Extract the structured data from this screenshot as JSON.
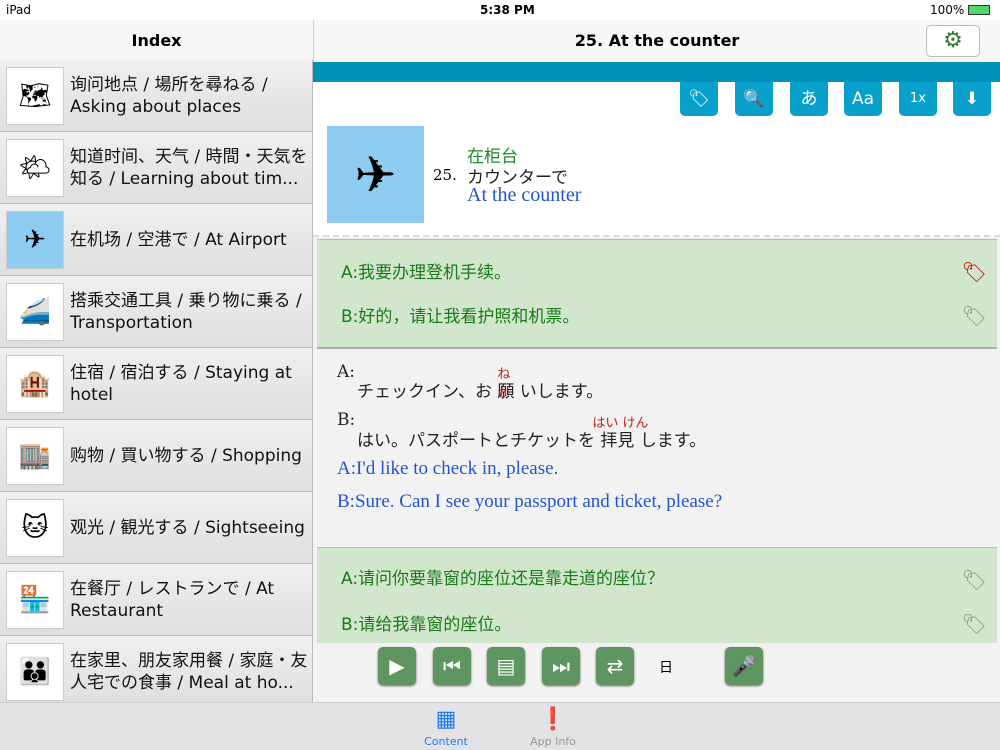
{
  "status": {
    "device": "iPad",
    "time": "5:38 PM",
    "battery": "100%"
  },
  "nav": {
    "left_title": "Index",
    "right_title": "25. At the counter"
  },
  "sidebar": {
    "items": [
      {
        "label": "询问地点 / 場所を尋ねる / Asking about places",
        "icon": "🗺"
      },
      {
        "label": "知道时间、天气 / 時間・天気を知る / Learning about tim...",
        "icon": "🌤"
      },
      {
        "label": "在机场 / 空港で / At Airport",
        "icon": "✈"
      },
      {
        "label": "搭乘交通工具 / 乗り物に乗る / Transportation",
        "icon": "🚄"
      },
      {
        "label": "住宿 / 宿泊する / Staying at hotel",
        "icon": "🏨"
      },
      {
        "label": "购物 / 買い物する / Shopping",
        "icon": "🏬"
      },
      {
        "label": "观光 / 観光する / Sightseeing",
        "icon": "🐱"
      },
      {
        "label": "在餐厅 / レストランで / At Restaurant",
        "icon": "🏪"
      },
      {
        "label": "在家里、朋友家用餐 / 家庭・友人宅での食事 / Meal at ho...",
        "icon": "👪"
      }
    ]
  },
  "toolbar": {
    "tag": "🏷",
    "search": "🔍",
    "kana": "あ",
    "font": "Aa",
    "speed": "1x",
    "download": "⬇"
  },
  "lesson": {
    "number": "25.",
    "zh": "在柜台",
    "ja": "カウンターで",
    "en": "At the counter",
    "image": "✈"
  },
  "dialog1": {
    "zh_a": "A:我要办理登机手续。",
    "zh_b": "B:好的，请让我看护照和机票。",
    "ja_a_label": "A:",
    "ja_a_pre": "チェックイン、お",
    "ja_a_kanji": "願",
    "ja_a_ruby": "ねが",
    "ja_a_post": "いします。",
    "ja_b_label": "B:",
    "ja_b_pre": "はい。パスポートとチケットを",
    "ja_b_kanji": "拝見",
    "ja_b_ruby": "はい けん",
    "ja_b_post": "します。",
    "en_a": "A:I'd like to check in, please.",
    "en_b": "B:Sure. Can I see your passport and ticket, please?"
  },
  "dialog2": {
    "zh_a": "A:请问你要靠窗的座位还是靠走道的座位？",
    "zh_b": "B:请给我靠窗的座位。"
  },
  "controls": {
    "lang": "日"
  },
  "tabs": [
    {
      "label": "Content",
      "active": true
    },
    {
      "label": "App Info",
      "active": false
    }
  ],
  "colors": {
    "accent": "#0aa0cc",
    "green": "#5e9560",
    "tab_active": "#1a7cf5"
  }
}
